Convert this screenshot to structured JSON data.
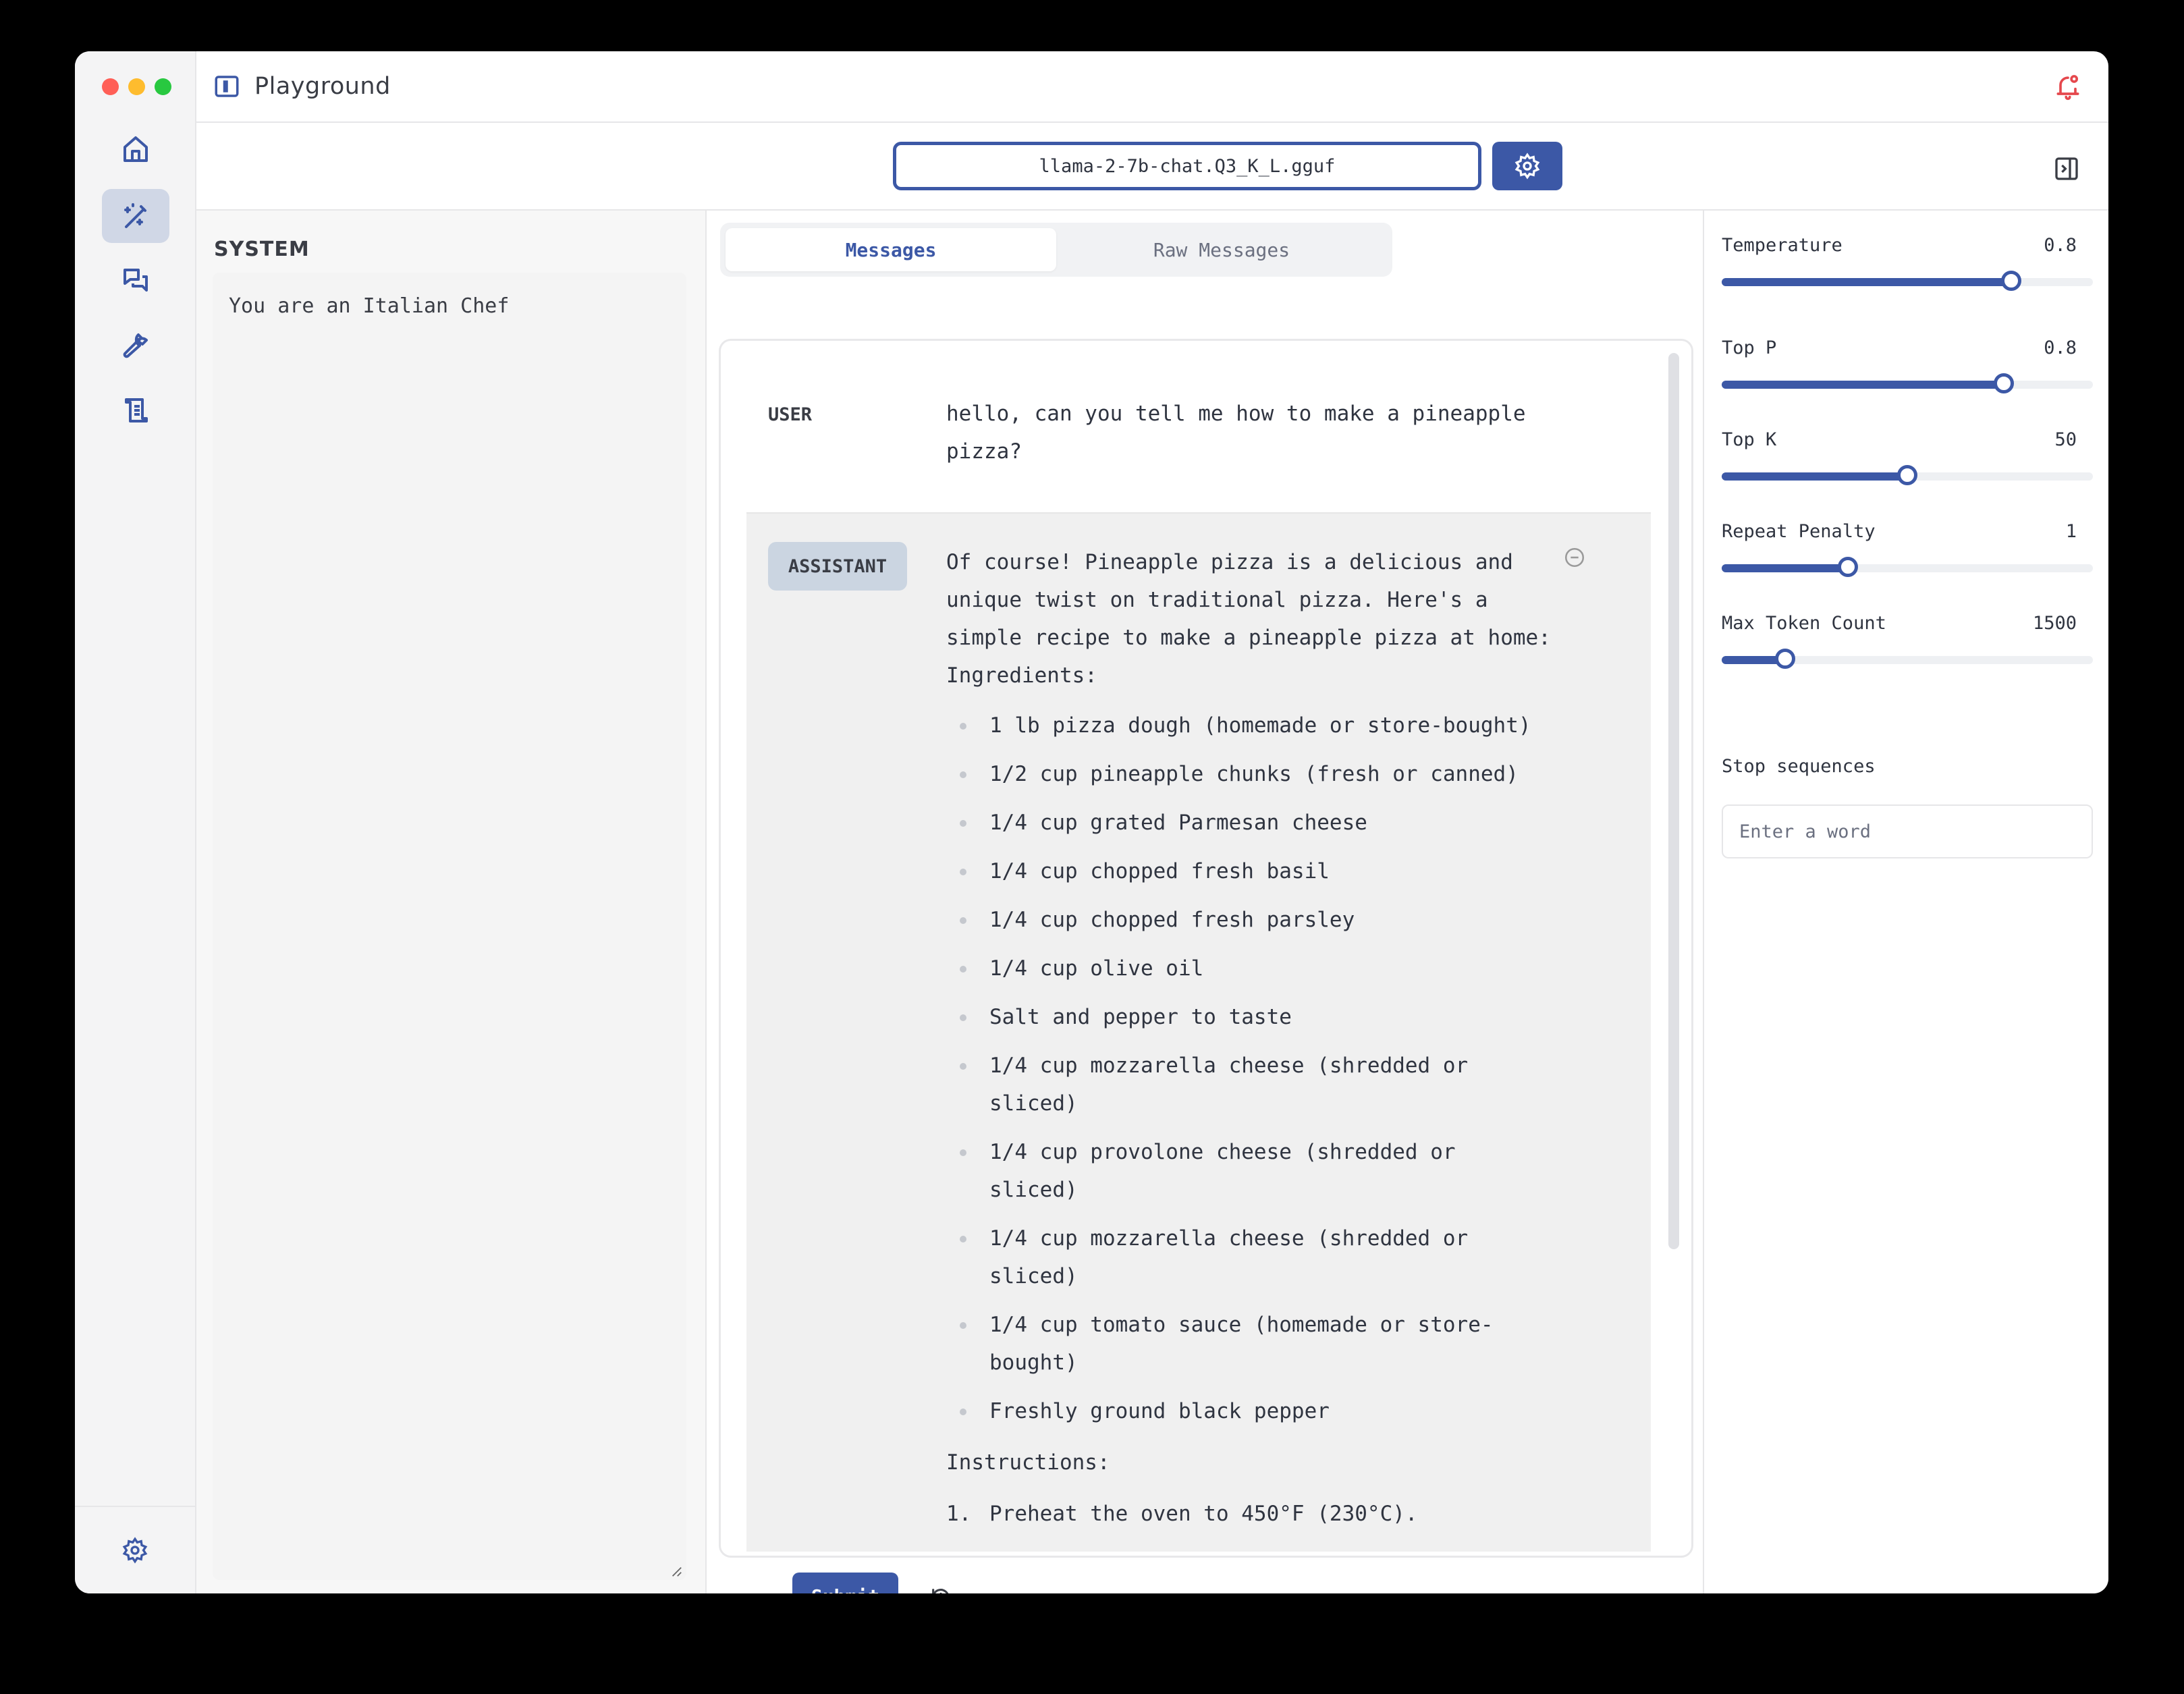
{
  "window": {
    "title": "Playground",
    "traffic_lights": [
      "#ff5f57",
      "#febc2e",
      "#28c840"
    ]
  },
  "nav": {
    "items": [
      {
        "name": "home",
        "icon": "home-icon",
        "active": false
      },
      {
        "name": "playground",
        "icon": "magic-wand-icon",
        "active": true
      },
      {
        "name": "chat",
        "icon": "chat-bubbles-icon",
        "active": false
      },
      {
        "name": "tools",
        "icon": "wrench-icon",
        "active": false
      },
      {
        "name": "logs",
        "icon": "scroll-icon",
        "active": false
      }
    ],
    "bottom_icon": "settings-gear-icon"
  },
  "header": {
    "notification_icon": "bell-icon",
    "accent": "#3c58a6",
    "alert_color": "#e5484d"
  },
  "model": {
    "selected": "llama-2-7b-chat.Q3_K_L.gguf",
    "settings_icon": "gear-icon"
  },
  "system": {
    "label": "SYSTEM",
    "prompt": "You are an Italian Chef"
  },
  "tabs": [
    {
      "label": "Messages",
      "active": true
    },
    {
      "label": "Raw Messages",
      "active": false
    }
  ],
  "messages": [
    {
      "role": "USER",
      "text": "hello, can you tell me how to make a pineapple pizza?"
    },
    {
      "role": "ASSISTANT",
      "intro": "Of course! Pineapple pizza is a delicious and unique twist on traditional pizza. Here's a simple recipe to make a pineapple pizza at home:",
      "ingredients_heading": "Ingredients:",
      "ingredients": [
        "1 lb pizza dough (homemade or store-bought)",
        "1/2 cup pineapple chunks (fresh or canned)",
        "1/4 cup grated Parmesan cheese",
        "1/4 cup chopped fresh basil",
        "1/4 cup chopped fresh parsley",
        "1/4 cup olive oil",
        "Salt and pepper to taste",
        "1/4 cup mozzarella cheese (shredded or sliced)",
        "1/4 cup provolone cheese (shredded or sliced)",
        "1/4 cup mozzarella cheese (shredded or sliced)",
        "1/4 cup tomato sauce (homemade or store-bought)",
        "Freshly ground black pepper"
      ],
      "instructions_heading": "Instructions:",
      "instructions": [
        {
          "num": "1.",
          "text": "Preheat the oven to 450°F (230°C)."
        }
      ]
    }
  ],
  "actions": {
    "submit_label": "Submit",
    "history_icon": "history-icon"
  },
  "params": {
    "sliders": [
      {
        "label": "Temperature",
        "value": "0.8",
        "fraction": 0.78
      },
      {
        "label": "Top P",
        "value": "0.8",
        "fraction": 0.76
      },
      {
        "label": "Top K",
        "value": "50",
        "fraction": 0.5
      },
      {
        "label": "Repeat Penalty",
        "value": "1",
        "fraction": 0.34
      },
      {
        "label": "Max Token Count",
        "value": "1500",
        "fraction": 0.17
      }
    ],
    "stop_label": "Stop sequences",
    "stop_placeholder": "Enter a word"
  }
}
